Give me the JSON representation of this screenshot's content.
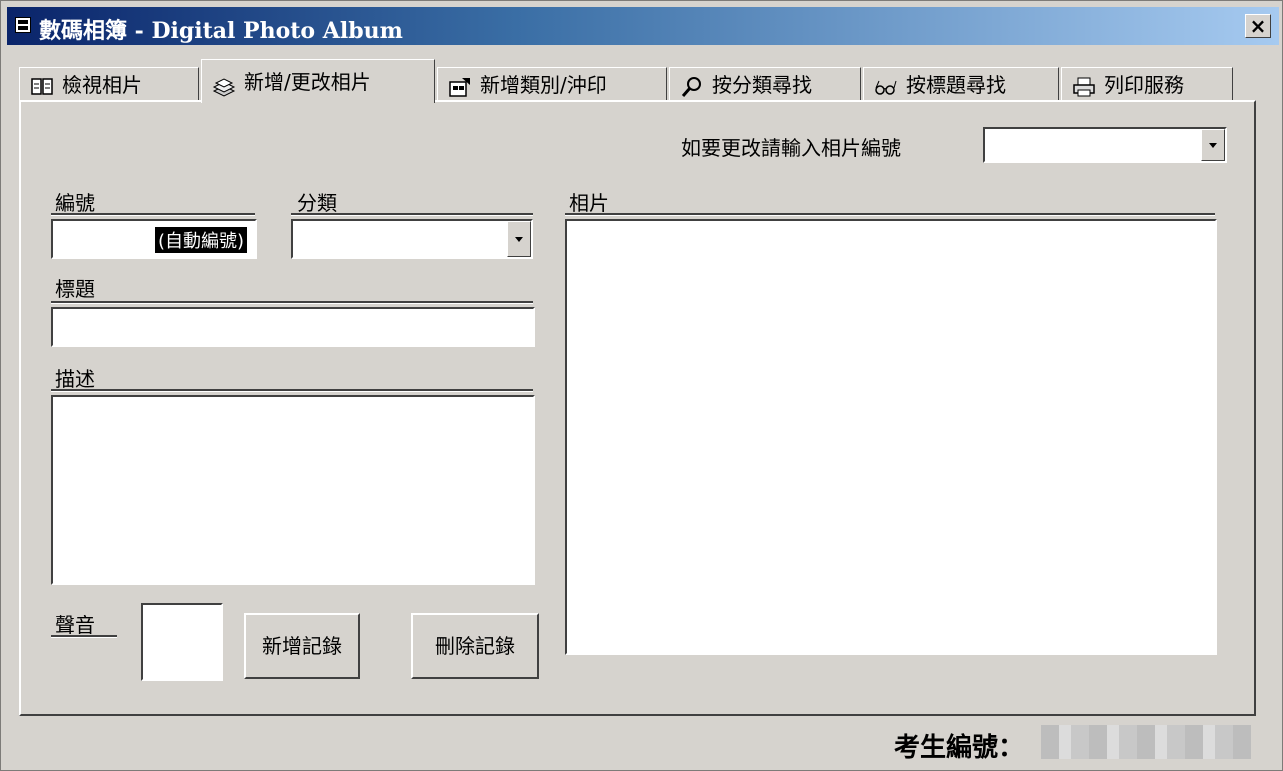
{
  "window": {
    "title": "數碼相簿 - Digital Photo Album",
    "close_label": "×"
  },
  "tabs": [
    {
      "label": "檢視相片",
      "icon": "book-icon",
      "active": false
    },
    {
      "label": "新增/更改相片",
      "icon": "photo-stack-icon",
      "active": true
    },
    {
      "label": "新增類別/沖印",
      "icon": "category-icon",
      "active": false
    },
    {
      "label": "按分類尋找",
      "icon": "magnifier-icon",
      "active": false
    },
    {
      "label": "按標題尋找",
      "icon": "glasses-icon",
      "active": false
    },
    {
      "label": "列印服務",
      "icon": "printer-icon",
      "active": false
    }
  ],
  "form": {
    "edit_prompt_label": "如要更改請輸入相片編號",
    "edit_select_value": "",
    "id_label": "編號",
    "id_value": "(自動編號)",
    "category_label": "分類",
    "category_value": "",
    "title_label": "標題",
    "title_value": "",
    "description_label": "描述",
    "description_value": "",
    "sound_label": "聲音",
    "photo_label": "相片",
    "add_button_label": "新增記錄",
    "delete_button_label": "刪除記錄"
  },
  "footer": {
    "candidate_label": "考生編號："
  }
}
